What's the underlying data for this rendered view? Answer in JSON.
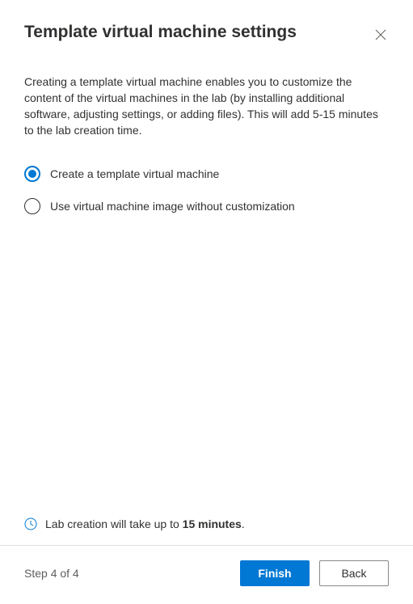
{
  "header": {
    "title": "Template virtual machine settings"
  },
  "description": "Creating a template virtual machine enables you to customize the content of the virtual machines in the lab (by installing additional software, adjusting settings, or adding files). This will add 5-15 minutes to the lab creation time.",
  "options": [
    {
      "label": "Create a template virtual machine",
      "selected": true
    },
    {
      "label": "Use virtual machine image without customization",
      "selected": false
    }
  ],
  "info": {
    "prefix": "Lab creation will take up to ",
    "duration": "15 minutes",
    "suffix": "."
  },
  "footer": {
    "step_label": "Step 4 of 4",
    "finish_label": "Finish",
    "back_label": "Back"
  },
  "colors": {
    "primary": "#0078d4"
  }
}
